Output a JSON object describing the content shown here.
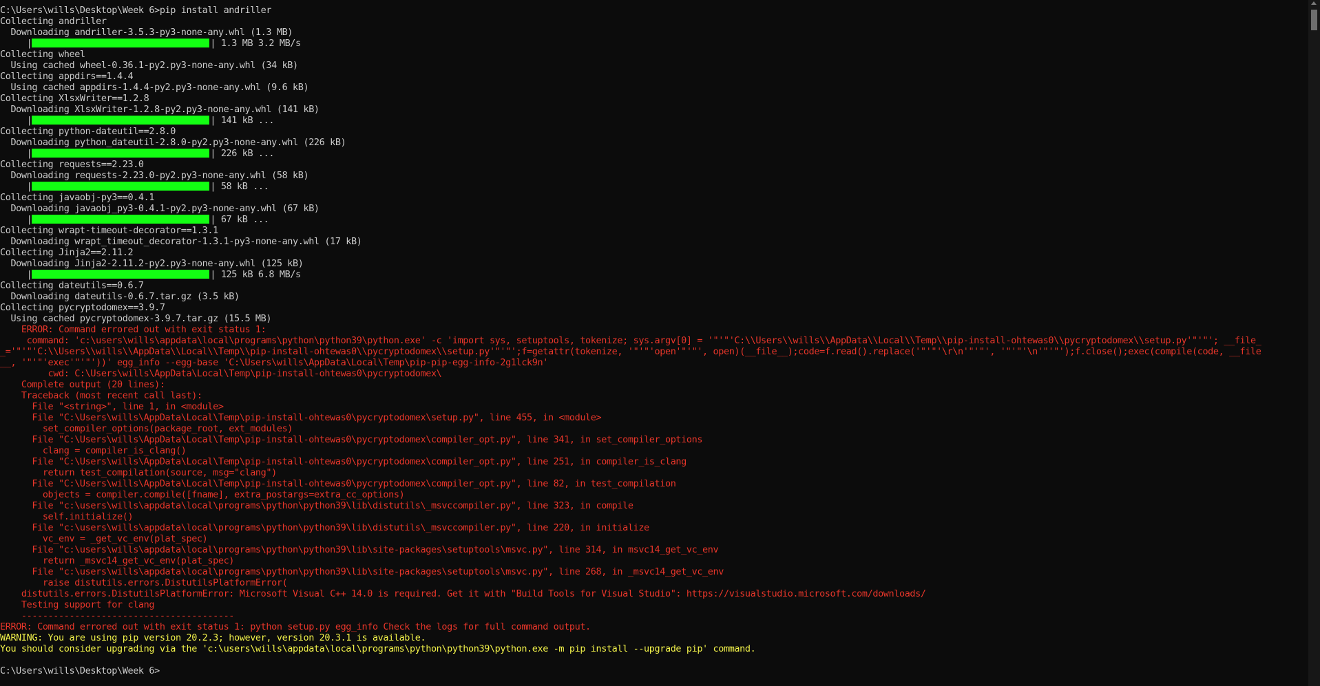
{
  "terminal": {
    "lines": [
      {
        "t": "normal",
        "text": "C:\\Users\\wills\\Desktop\\Week 6>pip install andriller"
      },
      {
        "t": "normal",
        "text": "Collecting andriller"
      },
      {
        "t": "normal",
        "text": "  Downloading andriller-3.5.3-py3-none-any.whl (1.3 MB)"
      },
      {
        "t": "progress",
        "prefix": "     |",
        "suffix": "| 1.3 MB 3.2 MB/s"
      },
      {
        "t": "normal",
        "text": "Collecting wheel"
      },
      {
        "t": "normal",
        "text": "  Using cached wheel-0.36.1-py2.py3-none-any.whl (34 kB)"
      },
      {
        "t": "normal",
        "text": "Collecting appdirs==1.4.4"
      },
      {
        "t": "normal",
        "text": "  Using cached appdirs-1.4.4-py2.py3-none-any.whl (9.6 kB)"
      },
      {
        "t": "normal",
        "text": "Collecting XlsxWriter==1.2.8"
      },
      {
        "t": "normal",
        "text": "  Downloading XlsxWriter-1.2.8-py2.py3-none-any.whl (141 kB)"
      },
      {
        "t": "progress",
        "prefix": "     |",
        "suffix": "| 141 kB ..."
      },
      {
        "t": "normal",
        "text": "Collecting python-dateutil==2.8.0"
      },
      {
        "t": "normal",
        "text": "  Downloading python_dateutil-2.8.0-py2.py3-none-any.whl (226 kB)"
      },
      {
        "t": "progress",
        "prefix": "     |",
        "suffix": "| 226 kB ..."
      },
      {
        "t": "normal",
        "text": "Collecting requests==2.23.0"
      },
      {
        "t": "normal",
        "text": "  Downloading requests-2.23.0-py2.py3-none-any.whl (58 kB)"
      },
      {
        "t": "progress",
        "prefix": "     |",
        "suffix": "| 58 kB ..."
      },
      {
        "t": "normal",
        "text": "Collecting javaobj-py3==0.4.1"
      },
      {
        "t": "normal",
        "text": "  Downloading javaobj_py3-0.4.1-py2.py3-none-any.whl (67 kB)"
      },
      {
        "t": "progress",
        "prefix": "     |",
        "suffix": "| 67 kB ..."
      },
      {
        "t": "normal",
        "text": "Collecting wrapt-timeout-decorator==1.3.1"
      },
      {
        "t": "normal",
        "text": "  Downloading wrapt_timeout_decorator-1.3.1-py3-none-any.whl (17 kB)"
      },
      {
        "t": "normal",
        "text": "Collecting Jinja2==2.11.2"
      },
      {
        "t": "normal",
        "text": "  Downloading Jinja2-2.11.2-py2.py3-none-any.whl (125 kB)"
      },
      {
        "t": "progress",
        "prefix": "     |",
        "suffix": "| 125 kB 6.8 MB/s"
      },
      {
        "t": "normal",
        "text": "Collecting dateutils==0.6.7"
      },
      {
        "t": "normal",
        "text": "  Downloading dateutils-0.6.7.tar.gz (3.5 kB)"
      },
      {
        "t": "normal",
        "text": "Collecting pycryptodomex==3.9.7"
      },
      {
        "t": "normal",
        "text": "  Using cached pycryptodomex-3.9.7.tar.gz (15.5 MB)"
      },
      {
        "t": "error",
        "text": "    ERROR: Command errored out with exit status 1:"
      },
      {
        "t": "error",
        "text": "     command: 'c:\\users\\wills\\appdata\\local\\programs\\python\\python39\\python.exe' -c 'import sys, setuptools, tokenize; sys.argv[0] = '\"'\"'C:\\\\Users\\\\wills\\\\AppData\\\\Local\\\\Temp\\\\pip-install-ohtewas0\\\\pycryptodomex\\\\setup.py'\"'\"'; __file_"
      },
      {
        "t": "error",
        "text": "_='\"'\"'C:\\\\Users\\\\wills\\\\AppData\\\\Local\\\\Temp\\\\pip-install-ohtewas0\\\\pycryptodomex\\\\setup.py'\"'\"';f=getattr(tokenize, '\"'\"'open'\"'\"', open)(__file__);code=f.read().replace('\"'\"'\\r\\n'\"'\"', '\"'\"'\\n'\"'\"');f.close();exec(compile(code, __file"
      },
      {
        "t": "error",
        "text": "__, '\"'\"'exec'\"'\"'))' egg_info --egg-base 'C:\\Users\\wills\\AppData\\Local\\Temp\\pip-pip-egg-info-2g1lck9n'"
      },
      {
        "t": "error",
        "text": "         cwd: C:\\Users\\wills\\AppData\\Local\\Temp\\pip-install-ohtewas0\\pycryptodomex\\"
      },
      {
        "t": "error",
        "text": "    Complete output (20 lines):"
      },
      {
        "t": "error",
        "text": "    Traceback (most recent call last):"
      },
      {
        "t": "error",
        "text": "      File \"<string>\", line 1, in <module>"
      },
      {
        "t": "error",
        "text": "      File \"C:\\Users\\wills\\AppData\\Local\\Temp\\pip-install-ohtewas0\\pycryptodomex\\setup.py\", line 455, in <module>"
      },
      {
        "t": "error",
        "text": "        set_compiler_options(package_root, ext_modules)"
      },
      {
        "t": "error",
        "text": "      File \"C:\\Users\\wills\\AppData\\Local\\Temp\\pip-install-ohtewas0\\pycryptodomex\\compiler_opt.py\", line 341, in set_compiler_options"
      },
      {
        "t": "error",
        "text": "        clang = compiler_is_clang()"
      },
      {
        "t": "error",
        "text": "      File \"C:\\Users\\wills\\AppData\\Local\\Temp\\pip-install-ohtewas0\\pycryptodomex\\compiler_opt.py\", line 251, in compiler_is_clang"
      },
      {
        "t": "error",
        "text": "        return test_compilation(source, msg=\"clang\")"
      },
      {
        "t": "error",
        "text": "      File \"C:\\Users\\wills\\AppData\\Local\\Temp\\pip-install-ohtewas0\\pycryptodomex\\compiler_opt.py\", line 82, in test_compilation"
      },
      {
        "t": "error",
        "text": "        objects = compiler.compile([fname], extra_postargs=extra_cc_options)"
      },
      {
        "t": "error",
        "text": "      File \"c:\\users\\wills\\appdata\\local\\programs\\python\\python39\\lib\\distutils\\_msvccompiler.py\", line 323, in compile"
      },
      {
        "t": "error",
        "text": "        self.initialize()"
      },
      {
        "t": "error",
        "text": "      File \"c:\\users\\wills\\appdata\\local\\programs\\python\\python39\\lib\\distutils\\_msvccompiler.py\", line 220, in initialize"
      },
      {
        "t": "error",
        "text": "        vc_env = _get_vc_env(plat_spec)"
      },
      {
        "t": "error",
        "text": "      File \"c:\\users\\wills\\appdata\\local\\programs\\python\\python39\\lib\\site-packages\\setuptools\\msvc.py\", line 314, in msvc14_get_vc_env"
      },
      {
        "t": "error",
        "text": "        return _msvc14_get_vc_env(plat_spec)"
      },
      {
        "t": "error",
        "text": "      File \"c:\\users\\wills\\appdata\\local\\programs\\python\\python39\\lib\\site-packages\\setuptools\\msvc.py\", line 268, in _msvc14_get_vc_env"
      },
      {
        "t": "error",
        "text": "        raise distutils.errors.DistutilsPlatformError("
      },
      {
        "t": "error",
        "text": "    distutils.errors.DistutilsPlatformError: Microsoft Visual C++ 14.0 is required. Get it with \"Build Tools for Visual Studio\": https://visualstudio.microsoft.com/downloads/"
      },
      {
        "t": "error",
        "text": "    Testing support for clang"
      },
      {
        "t": "error",
        "text": "    ----------------------------------------"
      },
      {
        "t": "error",
        "text": "ERROR: Command errored out with exit status 1: python setup.py egg_info Check the logs for full command output."
      },
      {
        "t": "warning",
        "text": "WARNING: You are using pip version 20.2.3; however, version 20.3.1 is available."
      },
      {
        "t": "warning",
        "text": "You should consider upgrading via the 'c:\\users\\wills\\appdata\\local\\programs\\python\\python39\\python.exe -m pip install --upgrade pip' command."
      },
      {
        "t": "blank",
        "text": ""
      },
      {
        "t": "normal",
        "text": "C:\\Users\\wills\\Desktop\\Week 6>"
      }
    ]
  },
  "colors": {
    "background": "#0c0c0c",
    "normal_text": "#cccccc",
    "error_text": "#e8362a",
    "warning_text": "#f1f14a",
    "progress_fill": "#13ff13"
  },
  "progress_bars": {
    "fill_fraction": 1.0
  }
}
